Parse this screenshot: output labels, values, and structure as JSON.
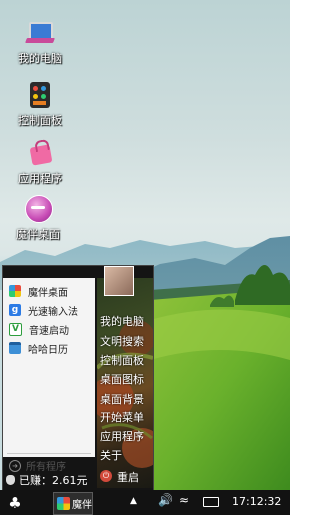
{
  "desktop": {
    "icons": [
      {
        "label": "我的电脑",
        "icon": "laptop-icon"
      },
      {
        "label": "控制面板",
        "icon": "palette-icon"
      },
      {
        "label": "应用程序",
        "icon": "shopping-bag-icon"
      },
      {
        "label": "魔伴桌面",
        "icon": "globe-icon"
      }
    ]
  },
  "start_menu": {
    "apps": [
      {
        "label": "魔伴桌面",
        "icon": "colorful-flower-icon"
      },
      {
        "label": "光速输入法",
        "icon": "keyboard-g-icon"
      },
      {
        "label": "音速启动",
        "icon": "v-launcher-icon"
      },
      {
        "label": "哈哈日历",
        "icon": "calendar-icon"
      }
    ],
    "all_programs": "所有程序",
    "earnings": "已赚：2.61元",
    "links": [
      "我的电脑",
      "文明搜索",
      "控制面板",
      "桌面图标",
      "桌面背景",
      "开始菜单",
      "应用程序",
      "关于"
    ],
    "shutdown": "重启"
  },
  "taskbar": {
    "app_label": "魔伴",
    "clock": "17:12:32"
  },
  "colors": {
    "taskbar": "#121212",
    "menu_left": "#f4f4f4",
    "accent_red": "#d24a3b"
  }
}
